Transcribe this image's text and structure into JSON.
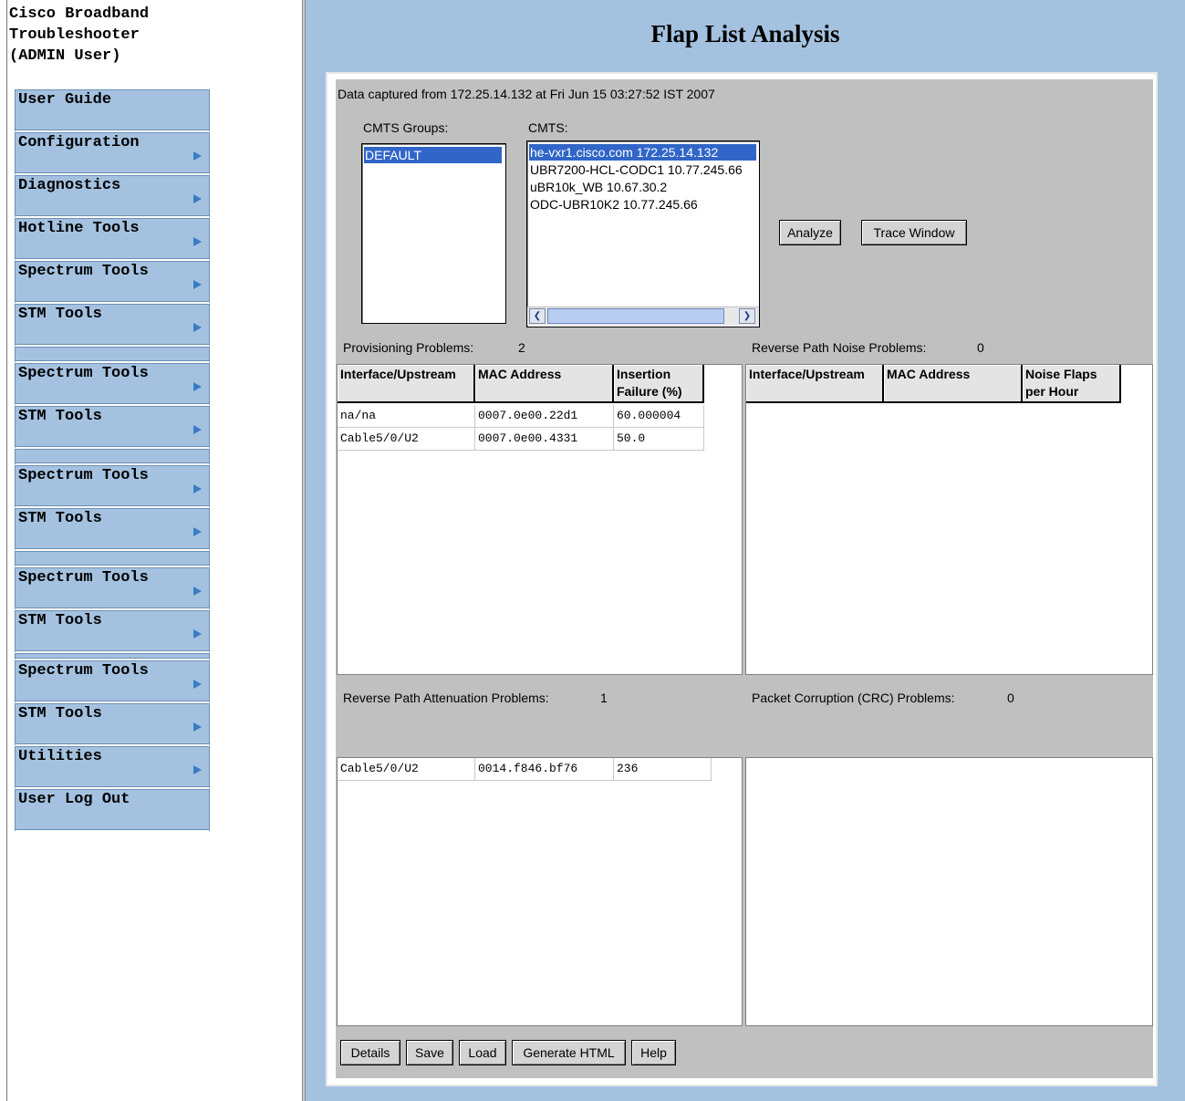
{
  "sidebar": {
    "title": "Cisco Broadband\nTroubleshooter\n(ADMIN User)",
    "items": [
      {
        "label": "User Guide",
        "arrow": false
      },
      {
        "label": "Configuration",
        "arrow": true
      },
      {
        "label": "Diagnostics",
        "arrow": true
      },
      {
        "label": "Hotline Tools",
        "arrow": true
      },
      {
        "label": "Spectrum Tools",
        "arrow": true
      },
      {
        "label": "STM Tools",
        "arrow": true
      },
      {
        "label": "",
        "arrow": false
      },
      {
        "label": "Spectrum Tools",
        "arrow": true
      },
      {
        "label": "STM Tools",
        "arrow": true
      },
      {
        "label": "",
        "arrow": false
      },
      {
        "label": "Spectrum Tools",
        "arrow": true
      },
      {
        "label": "STM Tools",
        "arrow": true
      },
      {
        "label": "",
        "arrow": false
      },
      {
        "label": "Spectrum Tools",
        "arrow": true
      },
      {
        "label": "STM Tools",
        "arrow": true
      },
      {
        "label": "",
        "arrow": false
      },
      {
        "label": "Spectrum Tools",
        "arrow": true
      },
      {
        "label": "STM Tools",
        "arrow": true
      },
      {
        "label": "Utilities",
        "arrow": true
      },
      {
        "label": "User Log Out",
        "arrow": false
      }
    ]
  },
  "main": {
    "title": "Flap List Analysis",
    "captured": "Data captured from 172.25.14.132 at Fri Jun 15 03:27:52 IST 2007",
    "cmts_groups_label": "CMTS Groups:",
    "cmts_groups": [
      "DEFAULT"
    ],
    "cmts_label": "CMTS:",
    "cmts": [
      "he-vxr1.cisco.com 172.25.14.132",
      "UBR7200-HCL-CODC1 10.77.245.66",
      "uBR10k_WB 10.67.30.2",
      "ODC-UBR10K2 10.77.245.66"
    ],
    "analyze_label": "Analyze",
    "trace_label": "Trace Window",
    "provisioning": {
      "label": "Provisioning Problems:",
      "count": "2",
      "headers": [
        "Interface/Upstream",
        "MAC Address",
        "Insertion Failure (%)"
      ],
      "rows": [
        [
          "na/na",
          "0007.0e00.22d1",
          "60.000004"
        ],
        [
          "Cable5/0/U2",
          "0007.0e00.4331",
          "50.0"
        ]
      ]
    },
    "noise": {
      "label": "Reverse Path Noise Problems:",
      "count": "0",
      "headers": [
        "Interface/Upstream",
        "MAC Address",
        "Noise Flaps per Hour"
      ]
    },
    "attenuation": {
      "label": "Reverse Path Attenuation Problems:",
      "count": "1",
      "rows": [
        [
          "Cable5/0/U2",
          "0014.f846.bf76",
          "236"
        ]
      ]
    },
    "crc": {
      "label": "Packet Corruption (CRC) Problems:",
      "count": "0"
    },
    "bottom_buttons": [
      "Details",
      "Save",
      "Load",
      "Generate HTML",
      "Help"
    ]
  }
}
